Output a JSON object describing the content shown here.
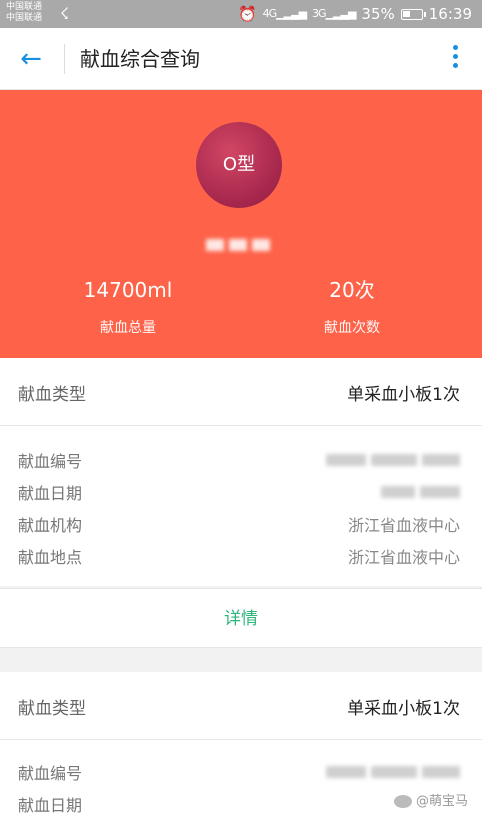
{
  "status_bar": {
    "carrier_1": "中国联通",
    "carrier_2": "中国联通",
    "network_1": "4G",
    "network_2": "3G",
    "battery": "35%",
    "time": "16:39"
  },
  "app_bar": {
    "title": "献血综合查询"
  },
  "summary": {
    "blood_type": "O型",
    "total_volume": "14700ml",
    "total_volume_label": "献血总量",
    "count": "20次",
    "count_label": "献血次数"
  },
  "records": [
    {
      "type_label": "献血类型",
      "type_value": "单采血小板1次",
      "fields": [
        {
          "label": "献血编号",
          "value": null
        },
        {
          "label": "献血日期",
          "value": null
        },
        {
          "label": "献血机构",
          "value": "浙江省血液中心"
        },
        {
          "label": "献血地点",
          "value": "浙江省血液中心"
        }
      ],
      "detail_label": "详情"
    },
    {
      "type_label": "献血类型",
      "type_value": "单采血小板1次",
      "fields": [
        {
          "label": "献血编号",
          "value": null
        },
        {
          "label": "献血日期",
          "value": null
        }
      ]
    }
  ],
  "watermark": "@萌宝马",
  "colors": {
    "hero_bg": "#fe6249",
    "accent": "#1a8fe0",
    "detail_link": "#2db57a"
  }
}
